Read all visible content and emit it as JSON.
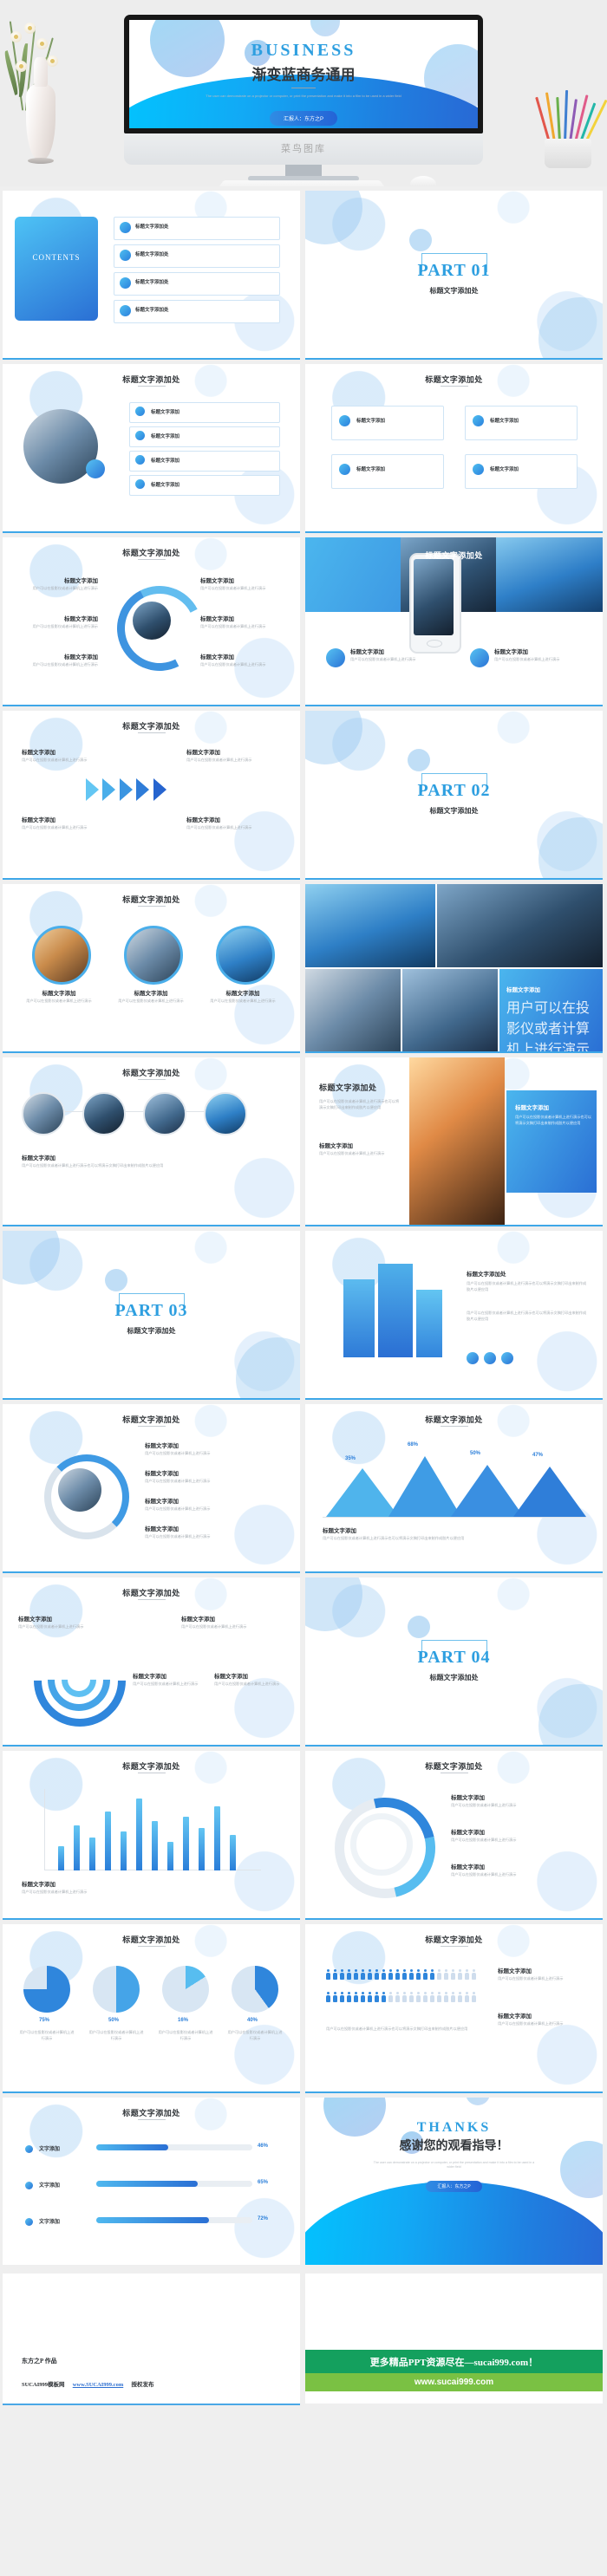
{
  "hero": {
    "monitor_label": "菜鸟图库",
    "title_slide": {
      "eyebrow": "BUSINESS",
      "title": "渐变蓝商务通用",
      "subtitle": "The user can demonstrate on a projector or computer, or print the presentation and make it into a film to be used in a wider field",
      "presenter_pill": "汇报人：东方之P"
    }
  },
  "common": {
    "heading": "标题文字添加",
    "body": "用户可以在投影仪或者计算机上进行演示也可以将演示文稿打印出来制作成胶片以便应用",
    "body_short": "用户可以在投影仪或者计算机上进行演示",
    "contents_label": "CONTENTS",
    "accent": "#2e9fe0",
    "accent_dark": "#2463d6"
  },
  "slides": [
    {
      "n": 1,
      "kind": "contents",
      "title": "CONTENTS",
      "items": [
        "标题文字添加处",
        "标题文字添加处",
        "标题文字添加处",
        "标题文字添加处"
      ]
    },
    {
      "n": 2,
      "kind": "part",
      "part": "PART 01",
      "subtitle": "标题文字添加处"
    },
    {
      "n": 3,
      "kind": "photo-list",
      "title": "标题文字添加处",
      "items": [
        "标题文字添加",
        "标题文字添加",
        "标题文字添加",
        "标题文字添加"
      ]
    },
    {
      "n": 4,
      "kind": "grid-chips",
      "title": "标题文字添加处",
      "items": [
        "标题文字添加",
        "标题文字添加",
        "标题文字添加",
        "标题文字添加"
      ]
    },
    {
      "n": 5,
      "kind": "cycle",
      "title": "标题文字添加处",
      "items": [
        "标题文字添加",
        "标题文字添加",
        "标题文字添加",
        "标题文字添加",
        "标题文字添加",
        "标题文字添加"
      ]
    },
    {
      "n": 6,
      "kind": "phone",
      "title": "标题文字添加处",
      "items": [
        "标题文字添加",
        "标题文字添加"
      ]
    },
    {
      "n": 7,
      "kind": "arrows",
      "title": "标题文字添加处",
      "items": [
        "标题文字添加",
        "标题文字添加",
        "标题文字添加",
        "标题文字添加"
      ]
    },
    {
      "n": 8,
      "kind": "part",
      "part": "PART 02",
      "subtitle": "标题文字添加处"
    },
    {
      "n": 9,
      "kind": "three-circ",
      "title": "标题文字添加处",
      "items": [
        "标题文字添加",
        "标题文字添加",
        "标题文字添加"
      ]
    },
    {
      "n": 10,
      "kind": "mosaic",
      "title": "标题文字添加处",
      "items": [
        "标题文字添加"
      ]
    },
    {
      "n": 11,
      "kind": "four-circ",
      "title": "标题文字添加处",
      "items": [
        "标题文字添加"
      ]
    },
    {
      "n": 12,
      "kind": "plane",
      "title": "标题文字添加处",
      "items": [
        "标题文字添加",
        "标题文字添加"
      ]
    },
    {
      "n": 13,
      "kind": "part",
      "part": "PART 03",
      "subtitle": "标题文字添加处"
    },
    {
      "n": 14,
      "kind": "building",
      "title": "标题文字添加处",
      "items": [
        "标题文字添加"
      ]
    },
    {
      "n": 15,
      "kind": "loop",
      "title": "标题文字添加处",
      "items": [
        "标题文字添加",
        "标题文字添加",
        "标题文字添加",
        "标题文字添加"
      ]
    },
    {
      "n": 16,
      "kind": "mountain",
      "title": "标题文字添加处",
      "values": [
        35,
        68,
        50,
        47
      ],
      "labels": [
        "35%",
        "68%",
        "50%",
        "47%"
      ]
    },
    {
      "n": 17,
      "kind": "wifi",
      "title": "标题文字添加处",
      "items": [
        "标题文字添加",
        "标题文字添加",
        "标题文字添加",
        "标题文字添加"
      ]
    },
    {
      "n": 18,
      "kind": "part",
      "part": "PART 04",
      "subtitle": "标题文字添加处"
    },
    {
      "n": 19,
      "kind": "barchart",
      "title": "标题文字添加处",
      "values": [
        30,
        55,
        40,
        72,
        48,
        88,
        60,
        35,
        66,
        52,
        78,
        44
      ]
    },
    {
      "n": 20,
      "kind": "ring",
      "title": "标题文字添加处",
      "items": [
        "标题文字添加",
        "标题文字添加",
        "标题文字添加"
      ]
    },
    {
      "n": 21,
      "kind": "pies",
      "title": "标题文字添加处",
      "values": [
        75,
        50,
        16,
        40
      ],
      "labels": [
        "75%",
        "50%",
        "16%",
        "40%"
      ]
    },
    {
      "n": 22,
      "kind": "people",
      "title": "标题文字添加处",
      "items": [
        "标题文字添加",
        "标题文字添加"
      ]
    },
    {
      "n": 23,
      "kind": "progress",
      "title": "标题文字添加处",
      "rows": [
        {
          "label": "文字添加",
          "pct": "46%",
          "v": 46
        },
        {
          "label": "文字添加",
          "pct": "65%",
          "v": 65
        },
        {
          "label": "文字添加",
          "pct": "72%",
          "v": 72
        }
      ]
    },
    {
      "n": 24,
      "kind": "thanks",
      "eyebrow": "THANKS",
      "title": "感谢您的观看指导！",
      "subtitle": "The user can demonstrate on a projector or computer, or print the presentation and make it into a film to be used in a wider field",
      "presenter_pill": "汇报人：东方之P"
    }
  ],
  "footer": {
    "author_line": "东方之P  作品",
    "credit_prefix": "SUCAI999模板网",
    "credit_link": "www.SUCAI999.com",
    "credit_suffix": "授权发布",
    "banner_green": "更多精品PPT资源尽在—sucai999.com！",
    "banner_light": "www.sucai999.com"
  }
}
